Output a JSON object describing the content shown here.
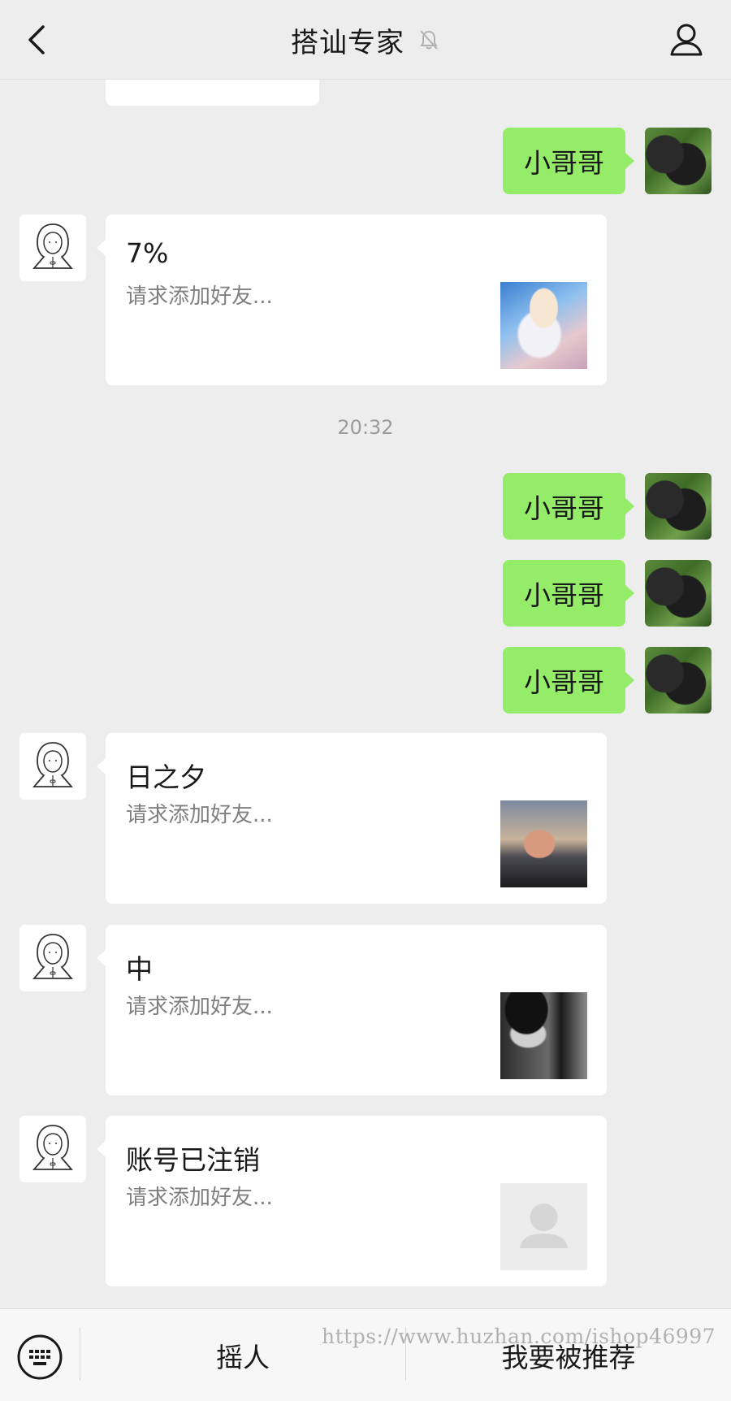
{
  "header": {
    "title": "搭讪专家"
  },
  "messages": {
    "outgoing_1": "小哥哥",
    "card_1": {
      "name": "7%",
      "desc": "请求添加好友..."
    },
    "timestamp": "20:32",
    "outgoing_2": "小哥哥",
    "outgoing_3": "小哥哥",
    "outgoing_4": "小哥哥",
    "card_2": {
      "name": "日之夕",
      "desc": "请求添加好友..."
    },
    "card_3": {
      "name": "中",
      "desc": "请求添加好友..."
    },
    "card_4": {
      "name": "账号已注销",
      "desc": "请求添加好友..."
    }
  },
  "toolbar": {
    "left_label": "摇人",
    "right_label": "我要被推荐"
  },
  "watermark": "https://www.huzhan.com/ishop46997",
  "colors": {
    "background": "#ededed",
    "outgoing_bubble": "#95ec69",
    "card": "#ffffff"
  }
}
